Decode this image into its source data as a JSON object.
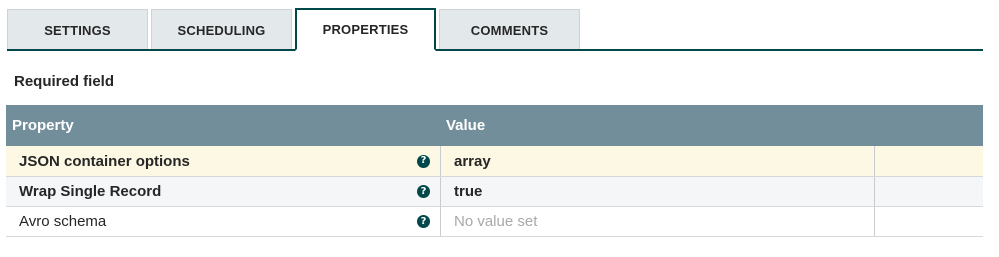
{
  "tabs": [
    {
      "label": "SETTINGS",
      "active": false
    },
    {
      "label": "SCHEDULING",
      "active": false
    },
    {
      "label": "PROPERTIES",
      "active": true
    },
    {
      "label": "COMMENTS",
      "active": false
    }
  ],
  "required_label": "Required field",
  "table": {
    "columns": [
      "Property",
      "Value"
    ],
    "rows": [
      {
        "property": "JSON container options",
        "value": "array",
        "required": true,
        "help_icon": "question-circle-icon"
      },
      {
        "property": "Wrap Single Record",
        "value": "true",
        "required": true,
        "help_icon": "question-circle-icon"
      },
      {
        "property": "Avro schema",
        "value": "No value set",
        "required": false,
        "help_icon": "question-circle-icon"
      }
    ]
  },
  "colors": {
    "accent": "#004849",
    "header_bg": "#728e9b",
    "highlight_row": "#fcf8e3"
  }
}
